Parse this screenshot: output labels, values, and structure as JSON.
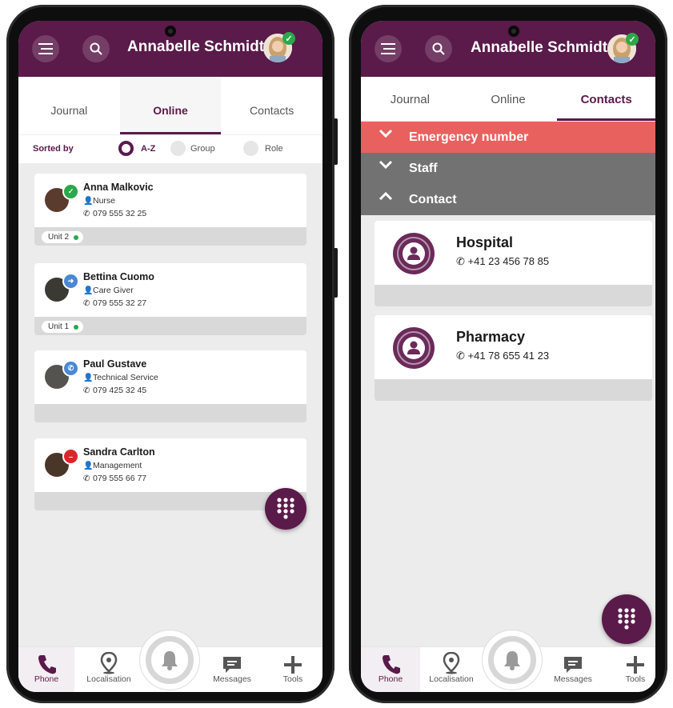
{
  "colors": {
    "brand": "#5a1a4a",
    "emergency": "#e8615f",
    "section": "#727272",
    "online": "#2aa84a",
    "dnd": "#d9262c",
    "forward": "#4a88d4"
  },
  "header": {
    "user_name": "Annabelle Schmidt",
    "menu_icon": "hamburger-menu-icon",
    "search_icon": "search-icon"
  },
  "phone1": {
    "tabs": [
      {
        "label": "Journal"
      },
      {
        "label": "Online"
      },
      {
        "label": "Contacts"
      }
    ],
    "active_tab": "Online",
    "sort": {
      "label": "Sorted by",
      "options": [
        "A-Z",
        "Group",
        "Role"
      ],
      "selected": "A-Z"
    },
    "contacts": [
      {
        "name": "Anna Malkovic",
        "role": "Nurse",
        "phone": "079 555 32 25",
        "unit": "Unit 2",
        "status": "available"
      },
      {
        "name": "Bettina Cuomo",
        "role": "Care Giver",
        "phone": "079 555 32 27",
        "unit": "Unit 1",
        "status": "forwarded"
      },
      {
        "name": "Paul Gustave",
        "role": "Technical Service",
        "phone": "079 425 32 45",
        "unit": "",
        "status": "on-call"
      },
      {
        "name": "Sandra Carlton",
        "role": "Management",
        "phone": "079 555 66 77",
        "unit": "",
        "status": "do-not-disturb"
      }
    ]
  },
  "phone2": {
    "tabs": [
      {
        "label": "Journal"
      },
      {
        "label": "Online"
      },
      {
        "label": "Contacts"
      }
    ],
    "active_tab": "Contacts",
    "sections": [
      {
        "label": "Emergency number",
        "state": "collapsed"
      },
      {
        "label": "Staff",
        "state": "collapsed"
      },
      {
        "label": "Contact",
        "state": "expanded"
      }
    ],
    "contacts": [
      {
        "name": "Hospital",
        "phone": "+41 23 456 78 85"
      },
      {
        "name": "Pharmacy",
        "phone": "+41 78 655 41 23"
      }
    ]
  },
  "nav": {
    "items": [
      {
        "label": "Phone",
        "icon": "phone-icon"
      },
      {
        "label": "Localisation",
        "icon": "location-pin-icon"
      },
      {
        "label": "Messages",
        "icon": "message-icon"
      },
      {
        "label": "Tools",
        "icon": "plus-icon"
      }
    ],
    "active": "Phone"
  }
}
